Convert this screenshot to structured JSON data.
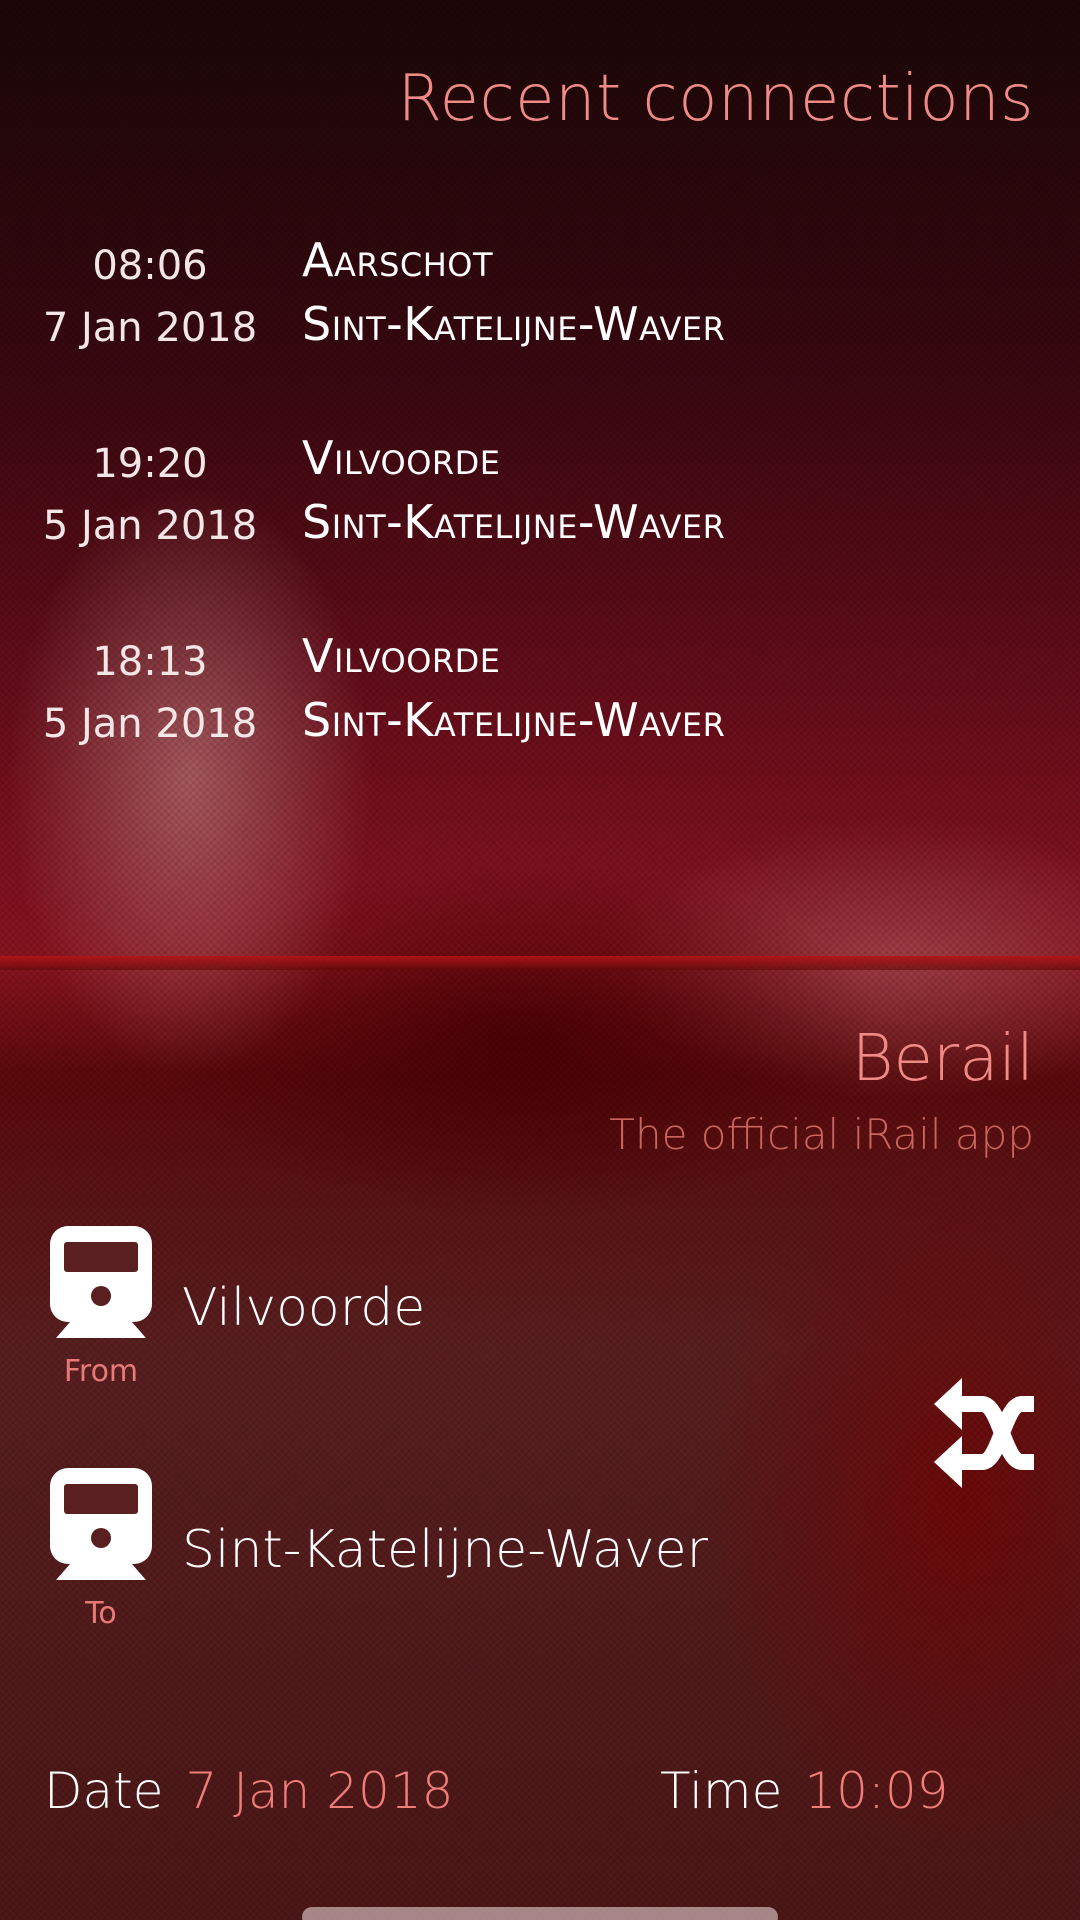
{
  "header": {
    "title": "Recent connections"
  },
  "recent": [
    {
      "time": "08:06",
      "date": "7 Jan 2018",
      "from": "Aarschot",
      "to": "Sint-Katelijne-Waver"
    },
    {
      "time": "19:20",
      "date": "5 Jan 2018",
      "from": "Vilvoorde",
      "to": "Sint-Katelijne-Waver"
    },
    {
      "time": "18:13",
      "date": "5 Jan 2018",
      "from": "Vilvoorde",
      "to": "Sint-Katelijne-Waver"
    }
  ],
  "app": {
    "title": "Berail",
    "subtitle": "The official iRail app"
  },
  "from": {
    "caption": "From",
    "station": "Vilvoorde",
    "icon": "train-icon"
  },
  "to": {
    "caption": "To",
    "station": "Sint-Katelijne-Waver",
    "icon": "train-icon"
  },
  "swap": {
    "icon": "shuffle-icon"
  },
  "date": {
    "label": "Date",
    "value": "7 Jan 2018"
  },
  "time": {
    "label": "Time",
    "value": "10:09"
  },
  "colors": {
    "accent": "#f08a86",
    "text": "#ffffff",
    "background": "#5a1f20"
  }
}
